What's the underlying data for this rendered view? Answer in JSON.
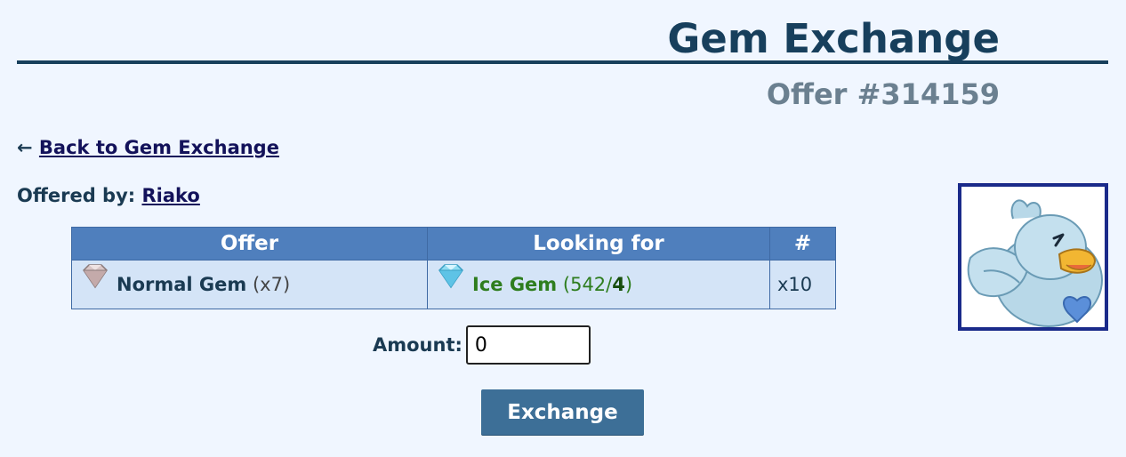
{
  "page": {
    "title": "Gem Exchange",
    "subtitle": "Offer #314159"
  },
  "nav": {
    "back_arrow": "←",
    "back_link": "Back to Gem Exchange"
  },
  "offered_by": {
    "label": "Offered by:",
    "user": "Riako"
  },
  "table": {
    "headers": [
      "Offer",
      "Looking for",
      "#"
    ],
    "row": {
      "offer": {
        "icon": "normal-gem-icon",
        "name": "Normal Gem",
        "qty": "(x7)"
      },
      "looking_for": {
        "icon": "ice-gem-icon",
        "name": "Ice Gem",
        "have": "542",
        "need": "4"
      },
      "count": "x10"
    }
  },
  "form": {
    "amount_label": "Amount:",
    "amount_value": "0",
    "submit_label": "Exchange"
  },
  "avatar": {
    "icon": "ducklett-avatar-icon"
  },
  "colors": {
    "background": "#f0f6ff",
    "title": "#173f5c",
    "subtitle": "#6b8090",
    "table_header": "#4f7fbd",
    "table_cell": "#d4e4f7",
    "ice_gem_text": "#2e7d1e",
    "button": "#3d6f97",
    "avatar_border": "#1a2a8a"
  }
}
